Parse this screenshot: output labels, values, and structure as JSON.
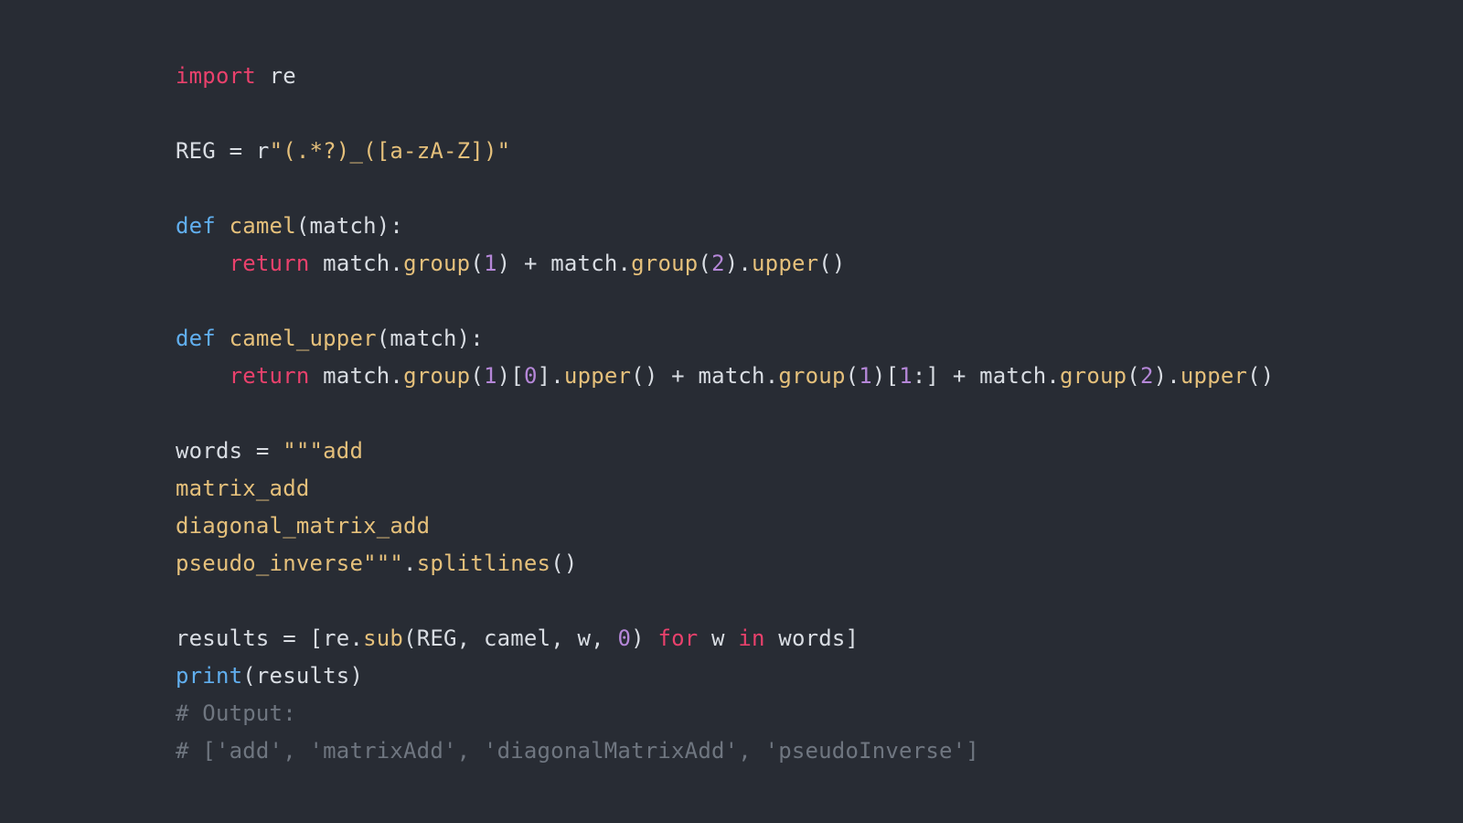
{
  "code": {
    "l1_import": "import",
    "l1_mod": "re",
    "l3_lhs": "REG",
    "l3_eq": " = ",
    "l3_rprefix": "r",
    "l3_str": "\"(.*?)_([a-zA-Z])\"",
    "l5_def": "def",
    "l5_name": "camel",
    "l5_params": "(match):",
    "l6_indent": "    ",
    "l6_return": "return",
    "l6_a": " match",
    "l6_dot1": ".",
    "l6_group1": "group",
    "l6_p1o": "(",
    "l6_n1": "1",
    "l6_p1c": ")",
    "l6_plus": " + ",
    "l6_b": "match",
    "l6_dot2": ".",
    "l6_group2": "group",
    "l6_p2o": "(",
    "l6_n2": "2",
    "l6_p2c": ")",
    "l6_dot3": ".",
    "l6_upper": "upper",
    "l6_pc": "()",
    "l8_def": "def",
    "l8_name": "camel_upper",
    "l8_params": "(match):",
    "l9_indent": "    ",
    "l9_return": "return",
    "l9_a": " match",
    "l9_dot1": ".",
    "l9_group1": "group",
    "l9_p1o": "(",
    "l9_n1": "1",
    "l9_p1c": ")[",
    "l9_idx0": "0",
    "l9_p1c2": "]",
    "l9_dot2": ".",
    "l9_upper1": "upper",
    "l9_pc1": "()",
    "l9_plus1": " + ",
    "l9_b": "match",
    "l9_dot3": ".",
    "l9_group2": "group",
    "l9_p2o": "(",
    "l9_n2": "1",
    "l9_p2c": ")[",
    "l9_idx1": "1",
    "l9_slice": ":] + ",
    "l9_c": "match",
    "l9_dot4": ".",
    "l9_group3": "group",
    "l9_p3o": "(",
    "l9_n3": "2",
    "l9_p3c": ")",
    "l9_dot5": ".",
    "l9_upper2": "upper",
    "l9_pc2": "()",
    "l11_lhs": "words",
    "l11_eq": " = ",
    "l11_str_open": "\"\"\"add",
    "l12_str": "matrix_add",
    "l13_str": "diagonal_matrix_add",
    "l14_str": "pseudo_inverse\"\"\"",
    "l14_dot": ".",
    "l14_split": "splitlines",
    "l14_pc": "()",
    "l16_lhs": "results",
    "l16_eq": " = [",
    "l16_re": "re",
    "l16_dot": ".",
    "l16_sub": "sub",
    "l16_args": "(REG, camel, w, ",
    "l16_zero": "0",
    "l16_close": ") ",
    "l16_for": "for",
    "l16_w": " w ",
    "l16_in": "in",
    "l16_words": " words]",
    "l17_print": "print",
    "l17_args": "(results)",
    "l18_comment": "# Output:",
    "l19_comment": "# ['add', 'matrixAdd', 'diagonalMatrixAdd', 'pseudoInverse']"
  }
}
